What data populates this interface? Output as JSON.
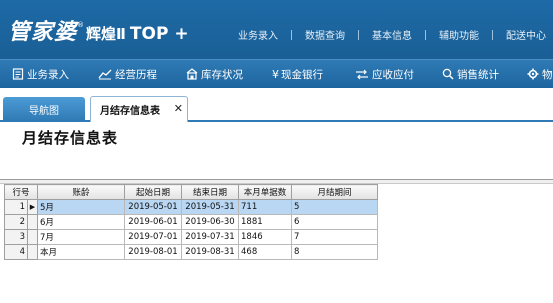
{
  "banner": {
    "brand_main": "管家婆",
    "brand_sup": "®",
    "brand_edition": "辉煌Ⅱ",
    "brand_top": "TOP +",
    "top_menu": [
      "业务录入",
      "数据查询",
      "基本信息",
      "辅助功能",
      "配送中心"
    ]
  },
  "toolbar": {
    "items": [
      {
        "label": "业务录入",
        "icon": "document-list-icon"
      },
      {
        "label": "经营历程",
        "icon": "trend-chart-icon"
      },
      {
        "label": "库存状况",
        "icon": "warehouse-icon"
      },
      {
        "label": "现金银行",
        "icon": "yen-icon"
      },
      {
        "label": "应收应付",
        "icon": "exchange-arrows-icon"
      },
      {
        "label": "销售统计",
        "icon": "search-icon"
      },
      {
        "label": "物",
        "icon": "gear-icon"
      }
    ]
  },
  "tabs": {
    "nav_label": "导航图",
    "active_label": "月结存信息表",
    "close_glyph": "✕"
  },
  "page": {
    "title": "月结存信息表"
  },
  "grid": {
    "columns": [
      "行号",
      "账龄",
      "起始日期",
      "结束日期",
      "本月单据数",
      "月结期间"
    ],
    "rows": [
      {
        "row_no": "1",
        "age": "5月",
        "start": "2019-05-01",
        "end": "2019-05-31",
        "docs": "711",
        "period": "5",
        "selected": true
      },
      {
        "row_no": "2",
        "age": "6月",
        "start": "2019-06-01",
        "end": "2019-06-30",
        "docs": "1881",
        "period": "6",
        "selected": false
      },
      {
        "row_no": "3",
        "age": "7月",
        "start": "2019-07-01",
        "end": "2019-07-31",
        "docs": "1846",
        "period": "7",
        "selected": false
      },
      {
        "row_no": "4",
        "age": "本月",
        "start": "2019-08-01",
        "end": "2019-08-31",
        "docs": "468",
        "period": "8",
        "selected": false
      }
    ],
    "current_row_marker": "▶"
  },
  "colors": {
    "banner": "#1d6aa6",
    "toolbar": "#2f7ab5",
    "selected_row": "#b9d7f3"
  }
}
